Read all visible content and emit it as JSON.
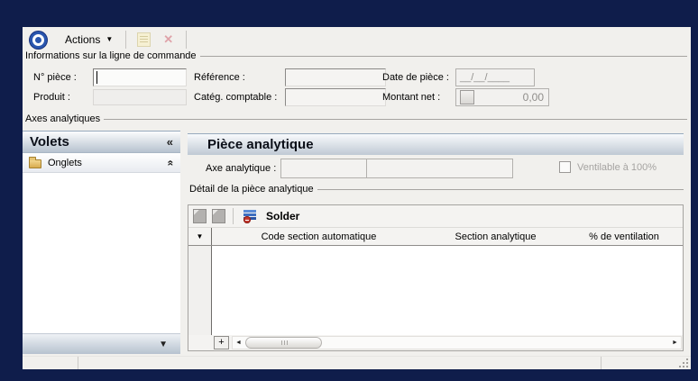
{
  "colors": {
    "window_frame": "#0f1d4b",
    "content_bg": "#f1f0ed",
    "panel_header_top": "#fbfcfd",
    "panel_header_bottom": "#b6c2cf",
    "accent_blue": "#2a56ae",
    "disabled_text": "#8f8d8a"
  },
  "toolbar": {
    "actions_label": "Actions",
    "caret_glyph": "▼"
  },
  "info_group": {
    "title": "Informations sur la ligne de commande",
    "fields": {
      "n_piece": {
        "label": "N° pièce :",
        "value": ""
      },
      "produit": {
        "label": "Produit :",
        "value": ""
      },
      "reference": {
        "label": "Référence :",
        "value": ""
      },
      "categ_comptable": {
        "label": "Catég. comptable :",
        "value": ""
      },
      "date_piece": {
        "label": "Date de pièce :",
        "value": "__/__/____"
      },
      "montant_net": {
        "label": "Montant net :",
        "value": "0,00"
      }
    }
  },
  "axes_group": {
    "title": "Axes analytiques"
  },
  "volets_panel": {
    "title": "Volets",
    "collapse_glyph": "«",
    "items": [
      {
        "label": "Onglets",
        "collapse_glyph": "«"
      }
    ],
    "footer_glyph": "▼"
  },
  "piece_panel": {
    "title": "Pièce analytique",
    "axe_label": "Axe analytique :",
    "axe_value_code": "",
    "axe_value_name": "",
    "checkbox_label": "Ventilable à 100%"
  },
  "detail_group": {
    "title": "Détail de la pièce analytique",
    "solder_label": "Solder",
    "table": {
      "selector_glyph": "▼",
      "columns": [
        "Code section automatique",
        "Section analytique",
        "% de ventilation"
      ],
      "rows": [],
      "add_button_label": "+",
      "scroll_left_glyph": "◄",
      "scroll_right_glyph": "►"
    }
  },
  "status_bar": {
    "left": "",
    "middle": "",
    "right": ""
  }
}
